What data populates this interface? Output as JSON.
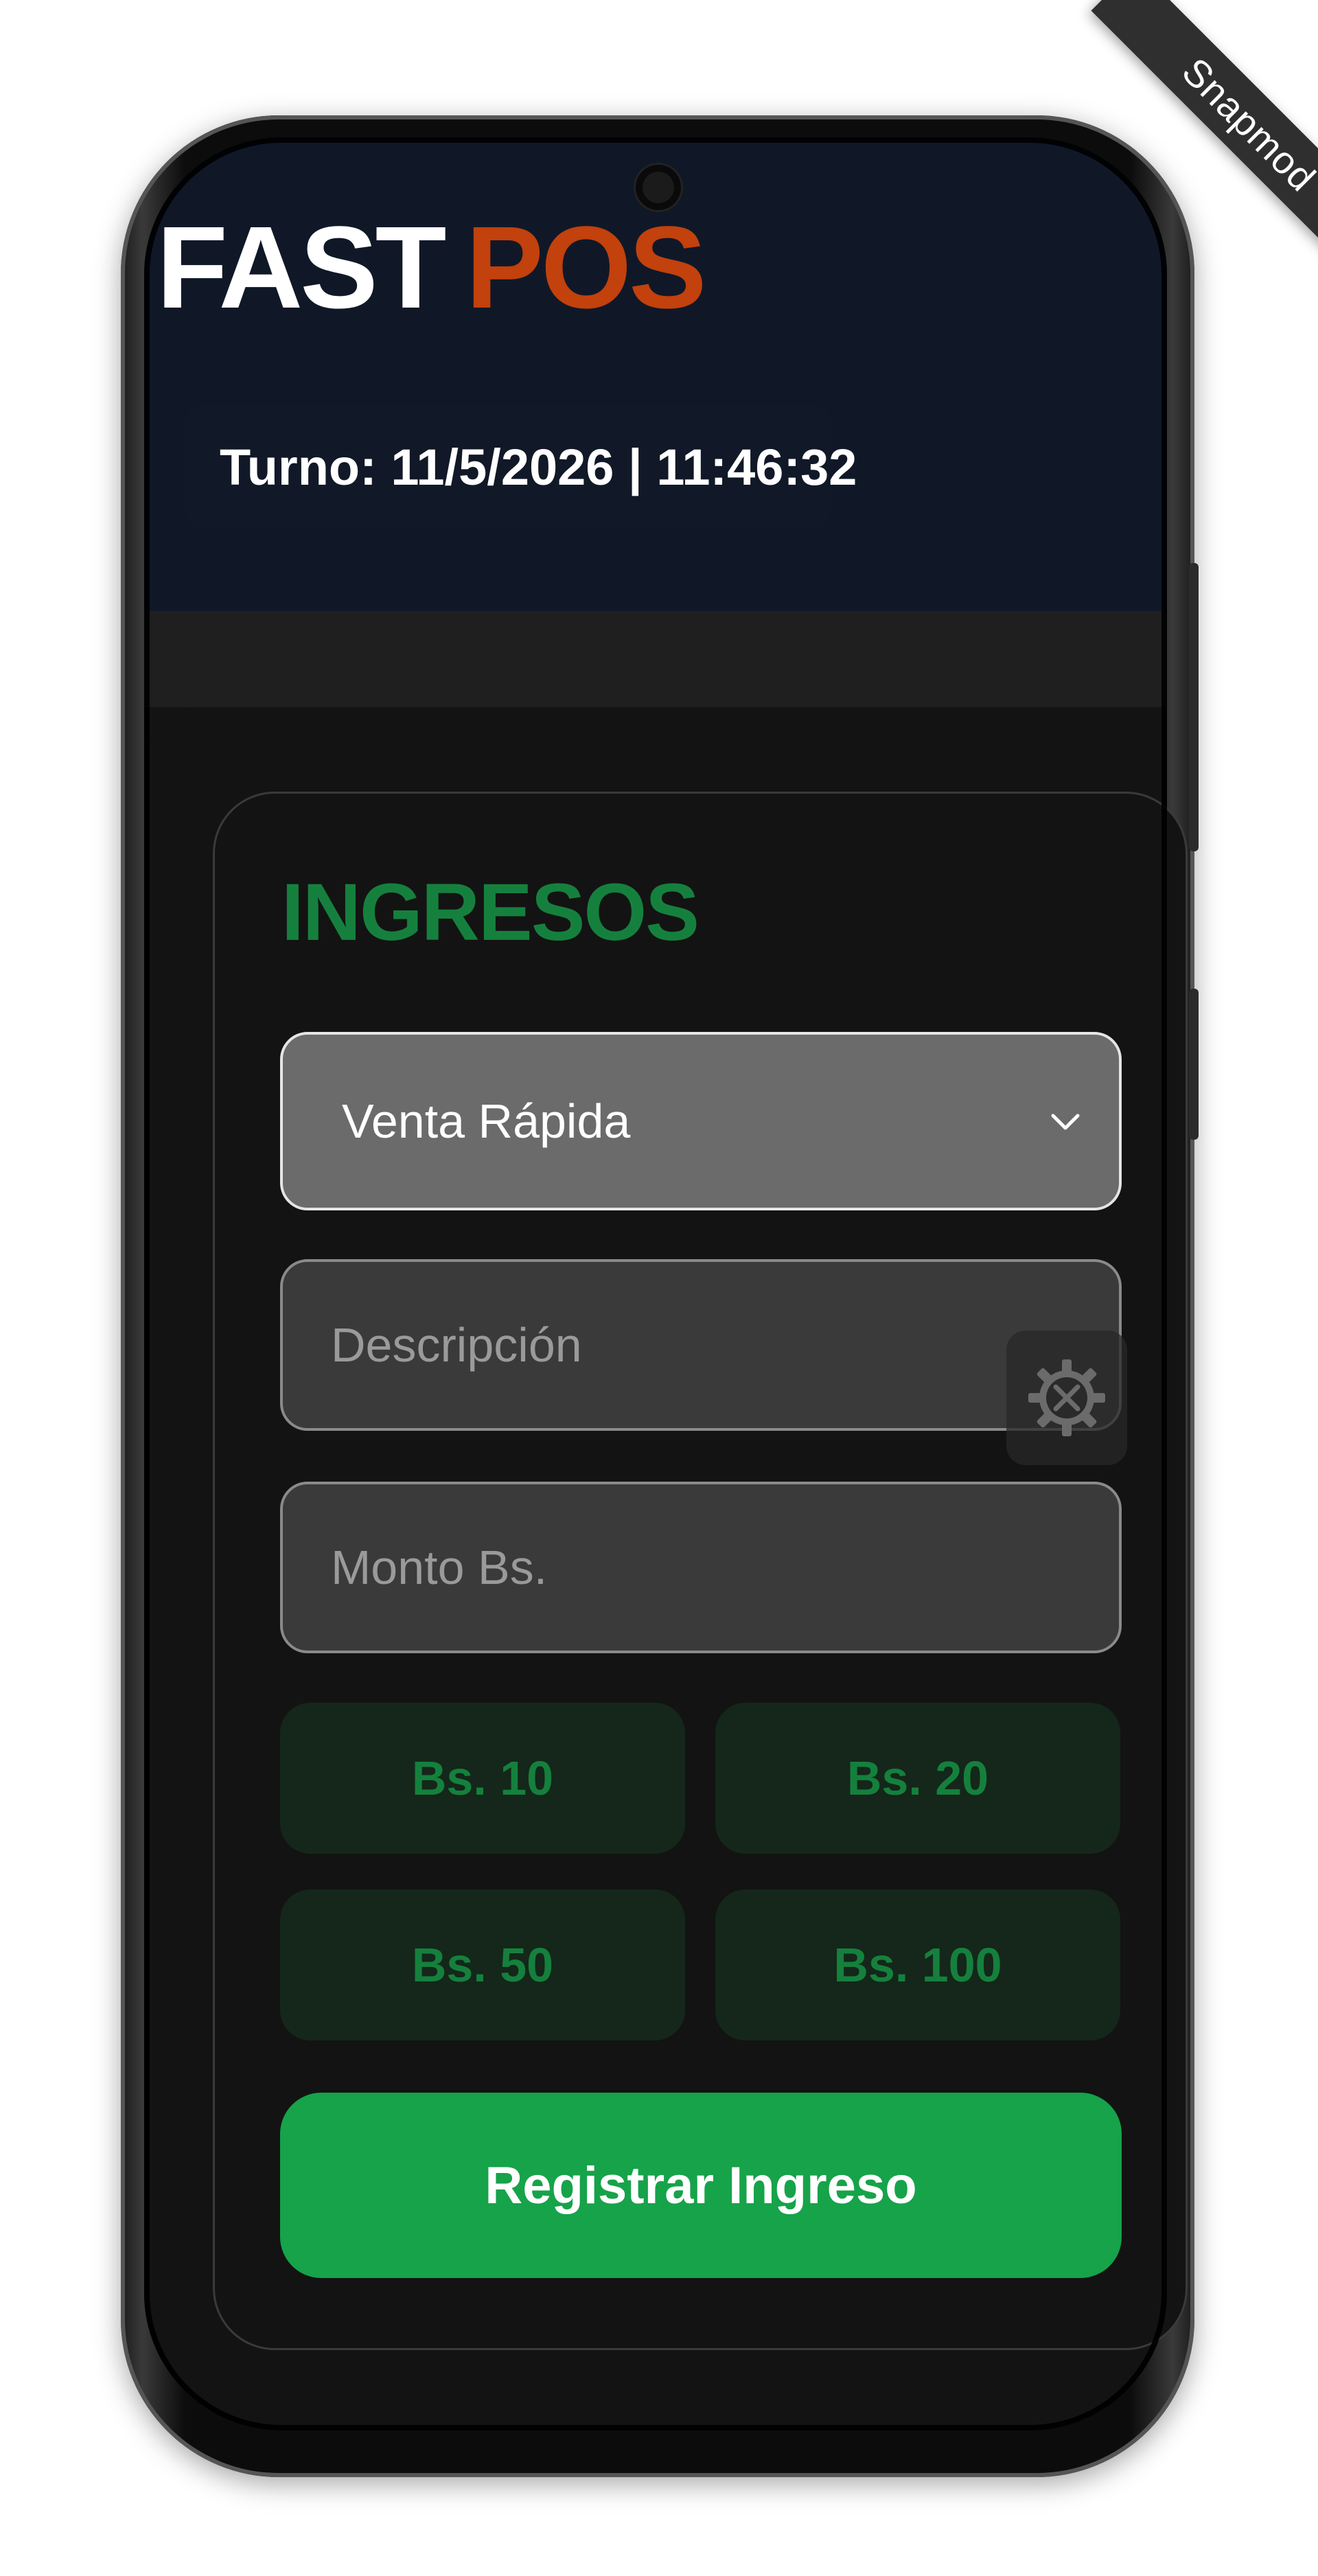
{
  "watermark": {
    "text": "Snapmod"
  },
  "app": {
    "brand_part1": "FAST",
    "brand_part2": "POS",
    "shift_label": "Turno: 11/5/2026 | 11:46:32"
  },
  "income_form": {
    "title": "INGRESOS",
    "category_select": {
      "value": "Venta Rápida"
    },
    "description_field": {
      "placeholder": "Descripción",
      "value": ""
    },
    "amount_field": {
      "placeholder": "Monto Bs.",
      "value": ""
    },
    "quick_amounts": [
      "Bs. 10",
      "Bs. 20",
      "Bs. 50",
      "Bs. 100"
    ],
    "submit_label": "Registrar Ingreso"
  },
  "icons": {
    "select_arrow": "chevron-down-icon",
    "floating_tool": "settings-tools-icon"
  },
  "colors": {
    "header_bg": "#101828",
    "brand_accent": "#c2410c",
    "income_green": "#15803d",
    "submit_green": "#16a34a",
    "quick_button_bg": "#14271a",
    "select_bg": "#6b6b6b",
    "field_bg": "#3a3a3a",
    "screen_bg": "#131313"
  }
}
